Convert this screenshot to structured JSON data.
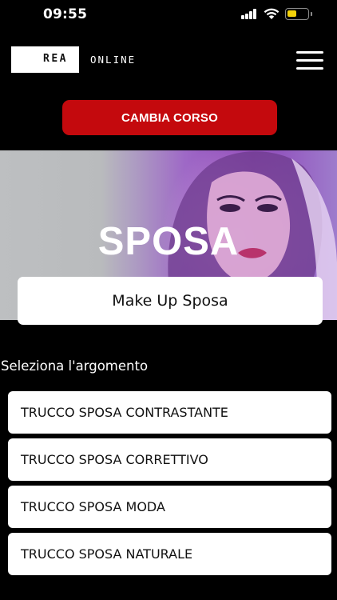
{
  "status": {
    "time": "09:55"
  },
  "header": {
    "logo_text": "REA",
    "logo_suffix": "ONLINE"
  },
  "change_course_label": "CAMBIA CORSO",
  "hero": {
    "title": "SPOSA",
    "course_name": "Make Up Sposa"
  },
  "topics": {
    "heading": "Seleziona l'argomento",
    "items": [
      "TRUCCO SPOSA CONTRASTANTE",
      "TRUCCO SPOSA CORRETTIVO",
      "TRUCCO SPOSA MODA",
      "TRUCCO SPOSA NATURALE"
    ]
  },
  "colors": {
    "accent": "#c4090d",
    "background": "#000000",
    "battery": "#f4d20a"
  }
}
